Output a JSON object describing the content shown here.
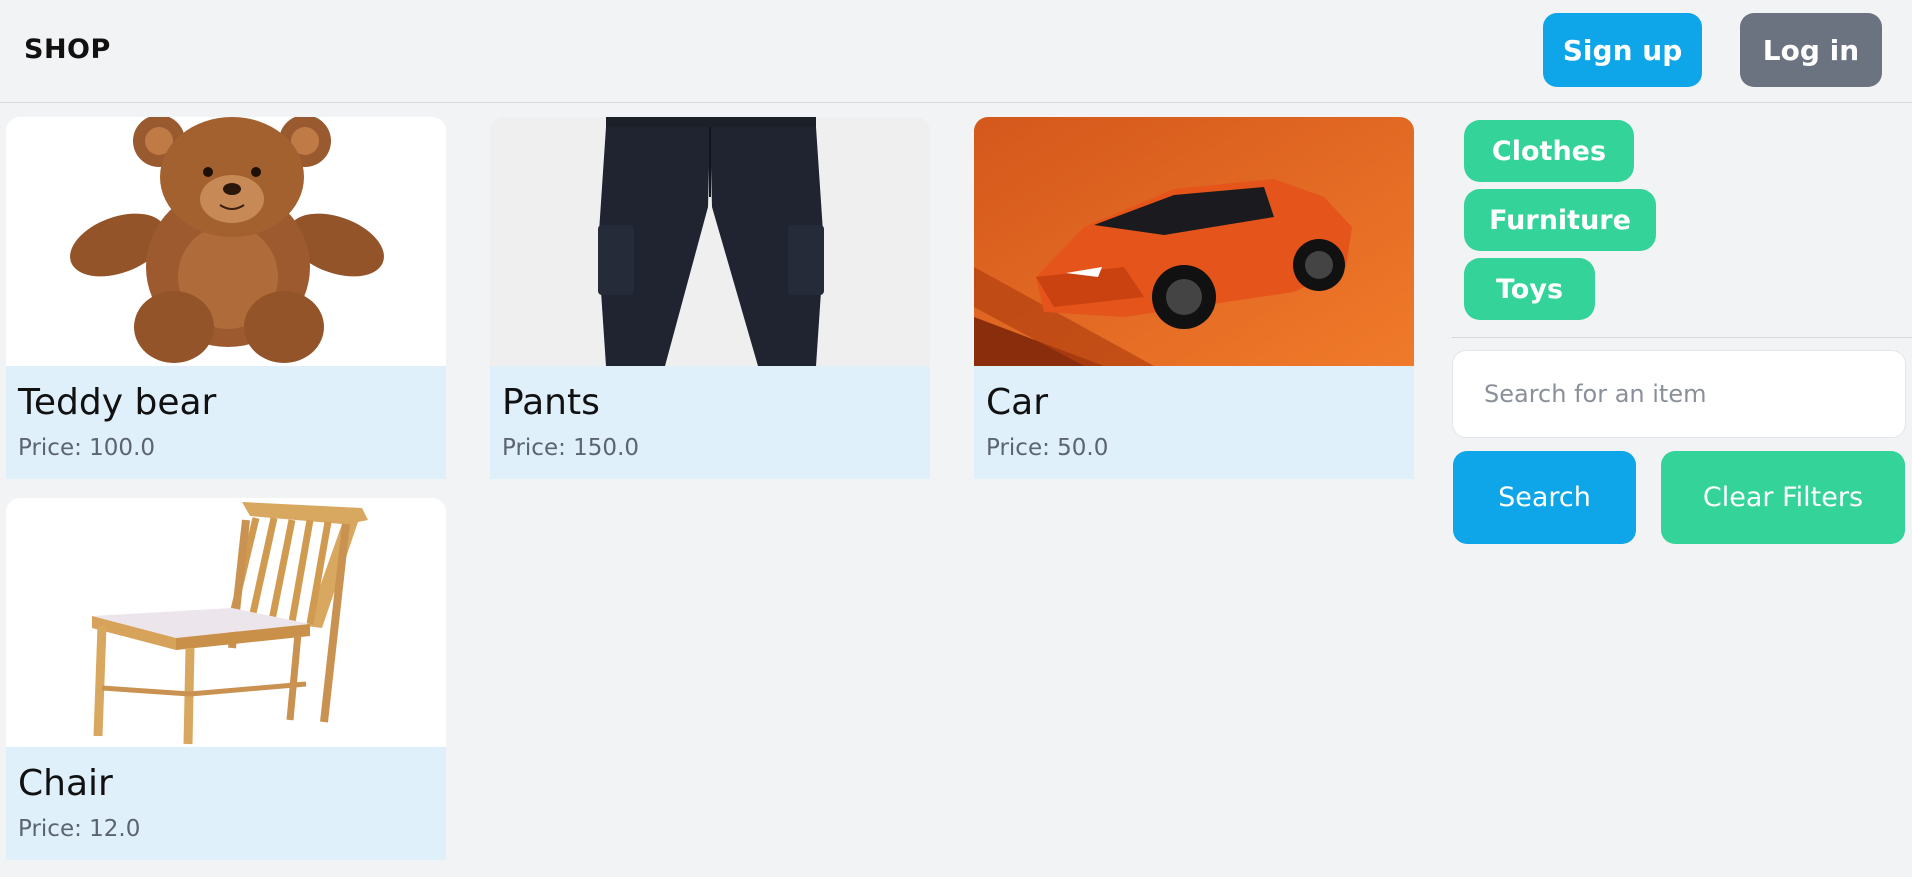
{
  "header": {
    "brand": "SHOP",
    "signup_label": "Sign up",
    "login_label": "Log in"
  },
  "products": [
    {
      "name": "Teddy bear",
      "price": "Price: 100.0"
    },
    {
      "name": "Pants",
      "price": "Price: 150.0"
    },
    {
      "name": "Car",
      "price": "Price: 50.0"
    },
    {
      "name": "Chair",
      "price": "Price: 12.0"
    }
  ],
  "sidebar": {
    "categories": [
      "Clothes",
      "Furniture",
      "Toys"
    ],
    "search": {
      "placeholder": "Search for an item",
      "value": ""
    },
    "search_label": "Search",
    "clear_label": "Clear Filters"
  },
  "colors": {
    "primary": "#0ea5e9",
    "secondary": "#6b7280",
    "accent": "#34d399",
    "card_bg": "#e0f0fb",
    "page_bg": "#f2f3f5"
  }
}
